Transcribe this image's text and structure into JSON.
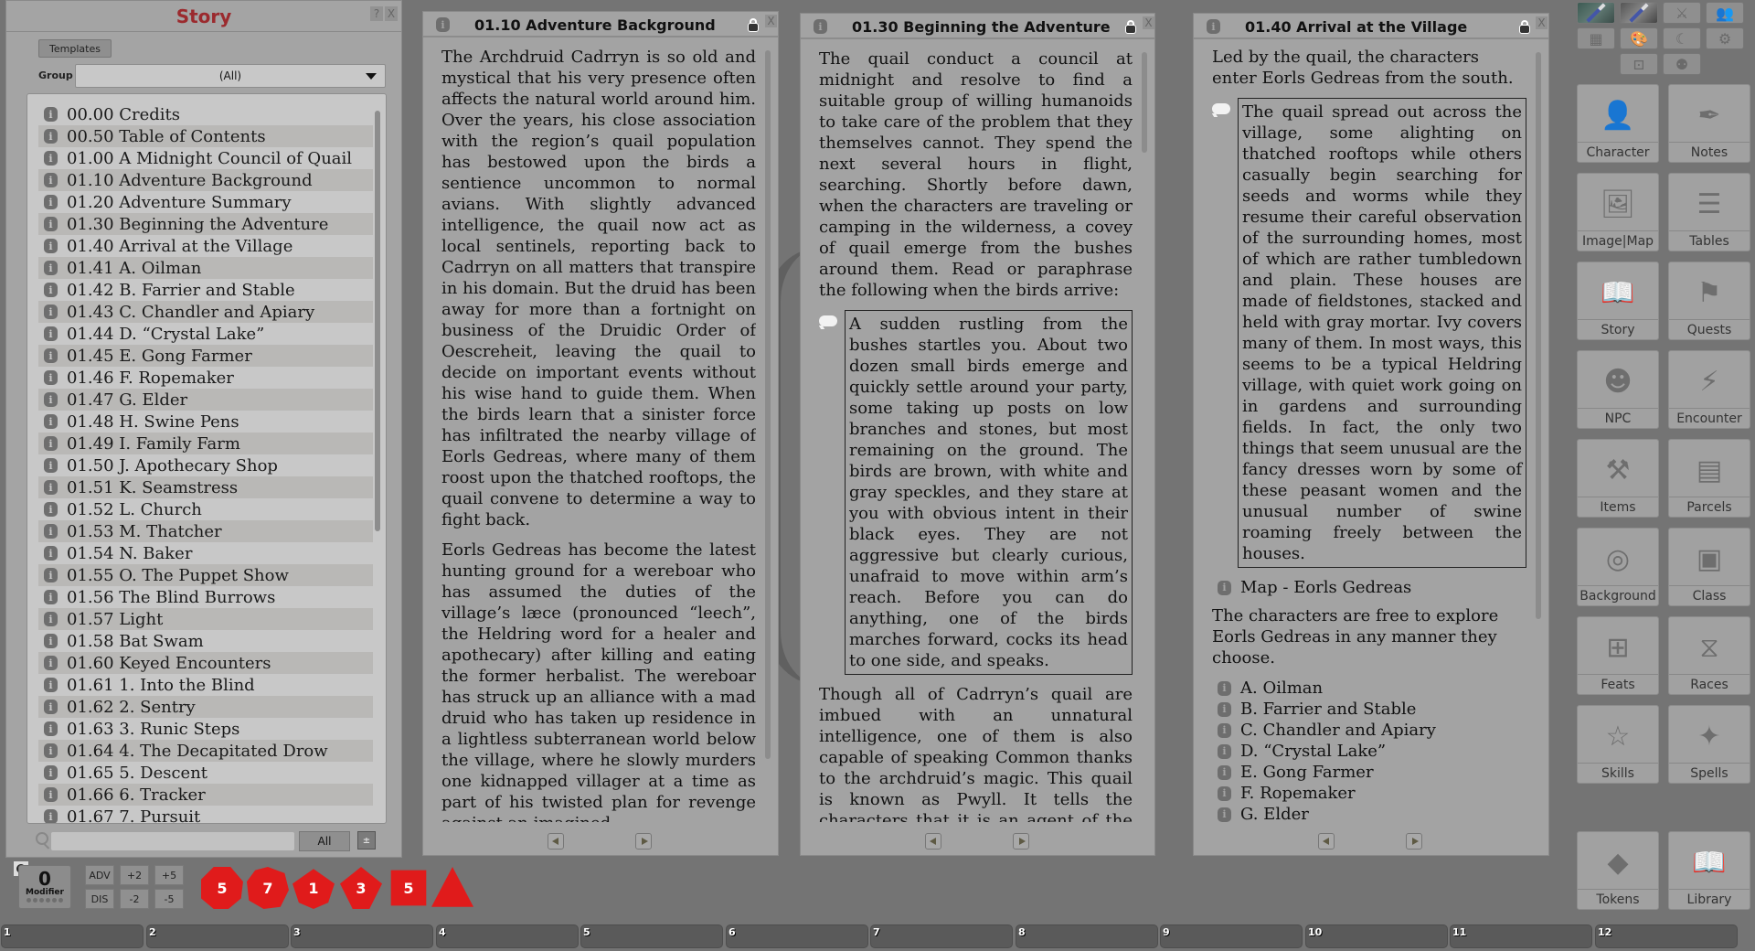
{
  "story_list": {
    "title": "Story",
    "help_label": "?",
    "close_label": "X",
    "templates_label": "Templates",
    "group_label": "Group",
    "group_value": "(All)",
    "items": [
      "00.00 Credits",
      "00.50 Table of Contents",
      "01.00 A Midnight Council of Quail",
      "01.10 Adventure Background",
      "01.20 Adventure Summary",
      "01.30 Beginning the Adventure",
      "01.40 Arrival at the Village",
      "01.41 A. Oilman",
      "01.42 B. Farrier and Stable",
      "01.43 C. Chandler and Apiary",
      "01.44 D. “Crystal Lake”",
      "01.45 E. Gong Farmer",
      "01.46 F. Ropemaker",
      "01.47 G. Elder",
      "01.48 H. Swine Pens",
      "01.49 I. Family Farm",
      "01.50  J. Apothecary Shop",
      "01.51 K. Seamstress",
      "01.52 L. Church",
      "01.53 M. Thatcher",
      "01.54 N. Baker",
      "01.55 O. The Puppet Show",
      "01.56 The Blind Burrows",
      "01.57 Light",
      "01.58 Bat Swam",
      "01.60 Keyed Encounters",
      "01.61 1. Into the Blind",
      "01.62 2. Sentry",
      "01.63 3. Runic Steps",
      "01.64 4. The Decapitated Drow",
      "01.65 5. Descent",
      "01.66 6. Tracker",
      "01.67 7. Pursuit"
    ],
    "search_value": "",
    "all_label": "All"
  },
  "windows": [
    {
      "title": "01.10 Adventure Background",
      "paragraphs": [
        "The Archdruid Cadrryn is so old and mystical that his very presence often affects the natural world around him. Over the years, his close association with the region’s quail population has bestowed upon the birds a sentience uncommon to normal avians. With slightly advanced intelligence, the quail now act as local sentinels, reporting back to Cadrryn on all matters that transpire in his domain. But the druid has been away for more than a fortnight on business of the Druidic Order of Oescreheit, leaving the quail to decide on important events without his wise hand to guide them. When the birds learn that a sinister force has infiltrated the nearby village of Eorls Gedreas, where many of them roost upon the thatched rooftops, the quail convene to determine a way to fight back.",
        "Eorls Gedreas has become the latest hunting ground for a wereboar who has assumed the duties of the village’s læce (pronounced “leech”, the Heldring word for a healer and apothecary) after killing and eating the former herbalist. The wereboar has struck up an alliance with a mad druid who has taken up residence in a lightless subterranean world below the village, where he slowly murders one kidnapped villager at a time as part of his twisted plan for revenge against an imagined"
      ]
    },
    {
      "title": "01.30 Beginning the Adventure",
      "intro": "The quail conduct a council at midnight and resolve to find a suitable group of willing humanoids to take care of the problem that they themselves cannot. They spend the next several hours in flight, searching. Shortly before dawn, when the characters are traveling or camping in the wilderness, a covey of quail emerge from the bushes around them. Read or paraphrase the following when the birds arrive:",
      "boxed": "A sudden rustling from the bushes startles you. About two dozen small birds emerge and quickly settle around your party, some taking up posts on low branches and stones, but most remaining on the ground. The birds are brown, with white and gray speckles, and they stare at you with obvious intent in their black eyes. They are not aggressive but clearly curious, unafraid to move within arm’s reach. Before you can do anything, one of the birds marches forward, cocks its head to one side, and speaks.",
      "outro": "Though all of Cadrryn’s quail are imbued with an unnatural intelligence, one of them is also capable of speaking Common thanks to the archdruid’s magic. This quail is known as Pwyll. It tells the characters that it is an agent of the archdruid"
    },
    {
      "title": "01.40 Arrival at the Village",
      "intro": "Led by the quail, the characters enter Eorls Gedreas from the south.",
      "boxed": "The quail spread out across the village, some alighting on thatched rooftops while others casually begin searching for seeds and worms while they resume their careful observation of the surrounding homes, most of which are rather tumbledown and plain. These houses are made of fieldstones, stacked and held with gray mortar. Ivy covers many of them. In most ways, this seems to be a typical Heldring village, with quiet work going on in gardens and surrounding fields. In fact, the only two things that seem unusual are the fancy dresses worn by some of these peasant women and the unusual number of swine roaming freely between the houses.",
      "map_link": "Map - Eorls Gedreas",
      "after": "The characters are free to explore Eorls Gedreas in any manner they choose.",
      "links": [
        "A. Oilman",
        "B. Farrier and Stable",
        "C. Chandler and Apiary",
        "D. “Crystal Lake”",
        "E. Gong Farmer",
        "F. Ropemaker",
        "G. Elder"
      ]
    }
  ],
  "close_label": "X",
  "sidebar": {
    "top_icons": [
      "image-tool-icon",
      "image-tool-alt-icon",
      "sword-icon",
      "users-icon",
      "calendar-icon",
      "palette-icon",
      "moon-stars-icon",
      "gear-icon",
      "focus-icon",
      "effects-icon"
    ],
    "buttons": [
      {
        "label": "Character",
        "icon": "character-icon"
      },
      {
        "label": "Notes",
        "icon": "quill-icon"
      },
      {
        "label": "Image|Map",
        "icon": "image-icon"
      },
      {
        "label": "Tables",
        "icon": "list-icon"
      },
      {
        "label": "Story",
        "icon": "book-icon"
      },
      {
        "label": "Quests",
        "icon": "flag-icon"
      },
      {
        "label": "NPC",
        "icon": "npc-icon"
      },
      {
        "label": "Encounter",
        "icon": "lightning-icon"
      },
      {
        "label": "Items",
        "icon": "anvil-icon"
      },
      {
        "label": "Parcels",
        "icon": "box-icon"
      },
      {
        "label": "Background",
        "icon": "fingerprint-icon"
      },
      {
        "label": "Class",
        "icon": "class-icon"
      },
      {
        "label": "Feats",
        "icon": "plus-box-icon"
      },
      {
        "label": "Races",
        "icon": "dna-icon"
      },
      {
        "label": "Skills",
        "icon": "star-icon"
      },
      {
        "label": "Spells",
        "icon": "wand-icon"
      },
      {
        "label": "Tokens",
        "icon": "layers-icon"
      },
      {
        "label": "Library",
        "icon": "reader-icon"
      }
    ]
  },
  "dice_tray": {
    "modifier_value": "0",
    "modifier_label": "Modifier",
    "adv_label": "ADV",
    "dis_label": "DIS",
    "plus2": "+2",
    "plus5": "+5",
    "minus2": "-2",
    "minus5": "-5",
    "dice": [
      {
        "name": "d20",
        "face": "5"
      },
      {
        "name": "d12",
        "face": "7"
      },
      {
        "name": "d10",
        "face": "1"
      },
      {
        "name": "d8",
        "face": "3"
      },
      {
        "name": "d6",
        "face": "5"
      },
      {
        "name": "d4",
        "face": ""
      }
    ],
    "die_color": "#e01b1b"
  },
  "hotbar": [
    "1",
    "2",
    "3",
    "4",
    "5",
    "6",
    "7",
    "8",
    "9",
    "10",
    "11",
    "12"
  ]
}
